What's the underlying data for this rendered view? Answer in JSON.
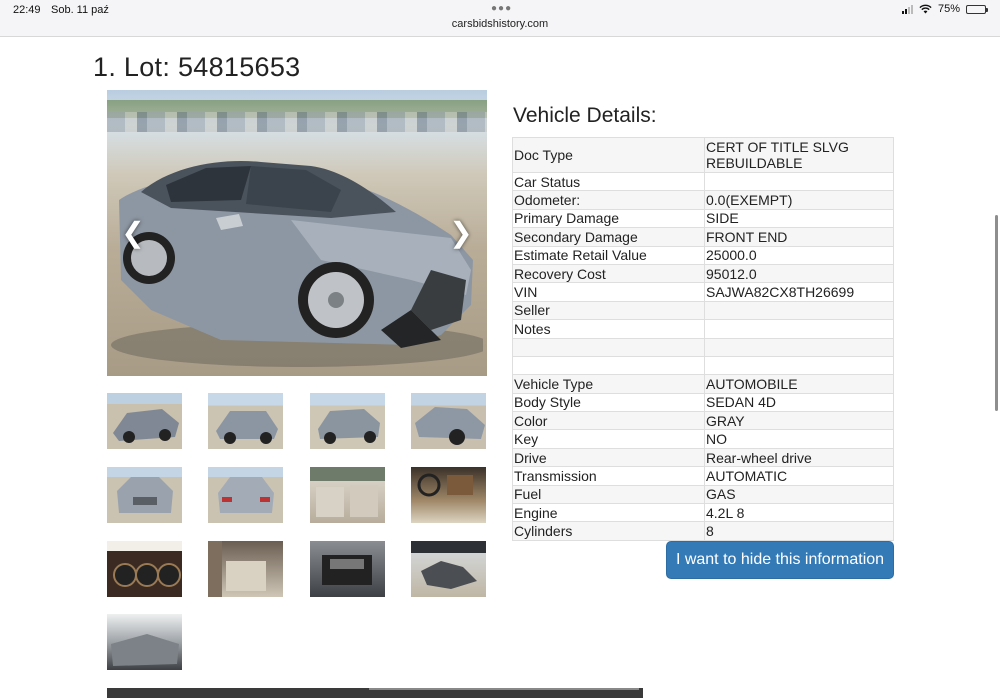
{
  "status_bar": {
    "time": "22:49",
    "date": "Sob. 11 paź",
    "url": "carsbidshistory.com",
    "battery": "75%"
  },
  "lot": {
    "title": "1. Lot: 54815653"
  },
  "gallery": {
    "prev_icon": "chevron-left-icon",
    "next_icon": "chevron-right-icon",
    "thumbnails": [
      "front-damage-photo",
      "rear-quarter-photo",
      "rear-photo",
      "side-photo",
      "front-photo",
      "rear-view-photo",
      "interior-front-seats-photo",
      "dashboard-photo",
      "instrument-cluster-photo",
      "rear-seats-photo",
      "engine-bay-photo",
      "parts-photo",
      "damage-closeup-photo"
    ]
  },
  "details": {
    "title": "Vehicle Details:",
    "rows": [
      {
        "key": "Doc Type",
        "value": "CERT OF TITLE SLVG REBUILDABLE"
      },
      {
        "key": "Car Status",
        "value": ""
      },
      {
        "key": "Odometer:",
        "value": "0.0(EXEMPT)"
      },
      {
        "key": "Primary Damage",
        "value": "SIDE"
      },
      {
        "key": "Secondary Damage",
        "value": "FRONT END"
      },
      {
        "key": "Estimate Retail Value",
        "value": "25000.0"
      },
      {
        "key": "Recovery Cost",
        "value": "95012.0"
      },
      {
        "key": "VIN",
        "value": "SAJWA82CX8TH26699"
      },
      {
        "key": "Seller",
        "value": ""
      },
      {
        "key": "Notes",
        "value": ""
      },
      {
        "key": "",
        "value": ""
      },
      {
        "key": "",
        "value": ""
      },
      {
        "key": "Vehicle Type",
        "value": "AUTOMOBILE"
      },
      {
        "key": "Body Style",
        "value": "SEDAN 4D"
      },
      {
        "key": "Color",
        "value": "GRAY"
      },
      {
        "key": "Key",
        "value": "NO"
      },
      {
        "key": "Drive",
        "value": "Rear-wheel drive"
      },
      {
        "key": "Transmission",
        "value": "AUTOMATIC"
      },
      {
        "key": "Fuel",
        "value": "GAS"
      },
      {
        "key": "Engine",
        "value": "4.2L 8"
      },
      {
        "key": "Cylinders",
        "value": "8"
      }
    ],
    "hide_button_label": "I want to hide this information"
  },
  "colors": {
    "button": "#337ab7",
    "row_stripe": "#f6f6f6",
    "border": "#dedede"
  }
}
